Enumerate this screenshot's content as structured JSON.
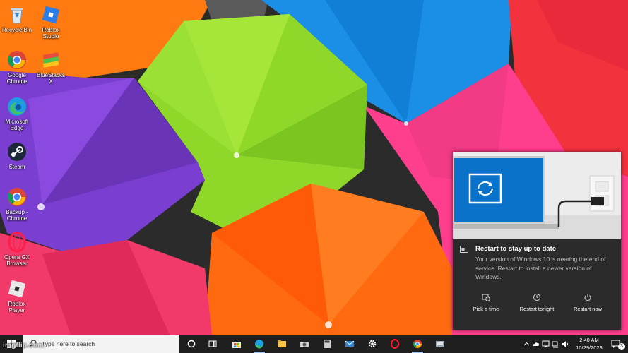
{
  "desktop": {
    "icons": [
      {
        "label": "Recycle Bin",
        "icon": "recycle-bin-icon"
      },
      {
        "label": "Roblox Studio",
        "icon": "roblox-studio-icon"
      },
      {
        "label": "Google Chrome",
        "icon": "chrome-icon"
      },
      {
        "label": "BlueStacks X",
        "icon": "bluestacks-icon"
      },
      {
        "label": "Microsoft Edge",
        "icon": "edge-icon"
      },
      {
        "label": "Steam",
        "icon": "steam-icon"
      },
      {
        "label": "Backup - Chrome",
        "icon": "chrome-backup-icon"
      },
      {
        "label": "Opera GX Browser",
        "icon": "opera-gx-icon"
      },
      {
        "label": "Roblox Player",
        "icon": "roblox-player-icon"
      }
    ]
  },
  "toast": {
    "title": "Restart to stay up to date",
    "body": "Your version of Windows 10 is nearing the end of service. Restart to install a newer version of Windows.",
    "actions": [
      {
        "label": "Pick a time",
        "icon": "calendar-clock-icon"
      },
      {
        "label": "Restart tonight",
        "icon": "restart-clock-icon"
      },
      {
        "label": "Restart now",
        "icon": "power-icon"
      }
    ]
  },
  "taskbar": {
    "search_placeholder": "Type here to search",
    "pinned": [
      "cortana-icon",
      "task-view-icon",
      "store-icon",
      "edge-icon",
      "file-explorer-icon",
      "camera-icon",
      "calculator-icon",
      "mail-icon",
      "settings-icon",
      "opera-icon",
      "chrome-icon",
      "other-app-icon"
    ],
    "clock": {
      "time": "2:40 AM",
      "date": "10/29/2023"
    },
    "notification_count": "3"
  },
  "watermark": "imgflip.com",
  "colors": {
    "taskbar": "#1f1f1f",
    "toast": "#2b2b2b",
    "accent": "#0078d7"
  }
}
